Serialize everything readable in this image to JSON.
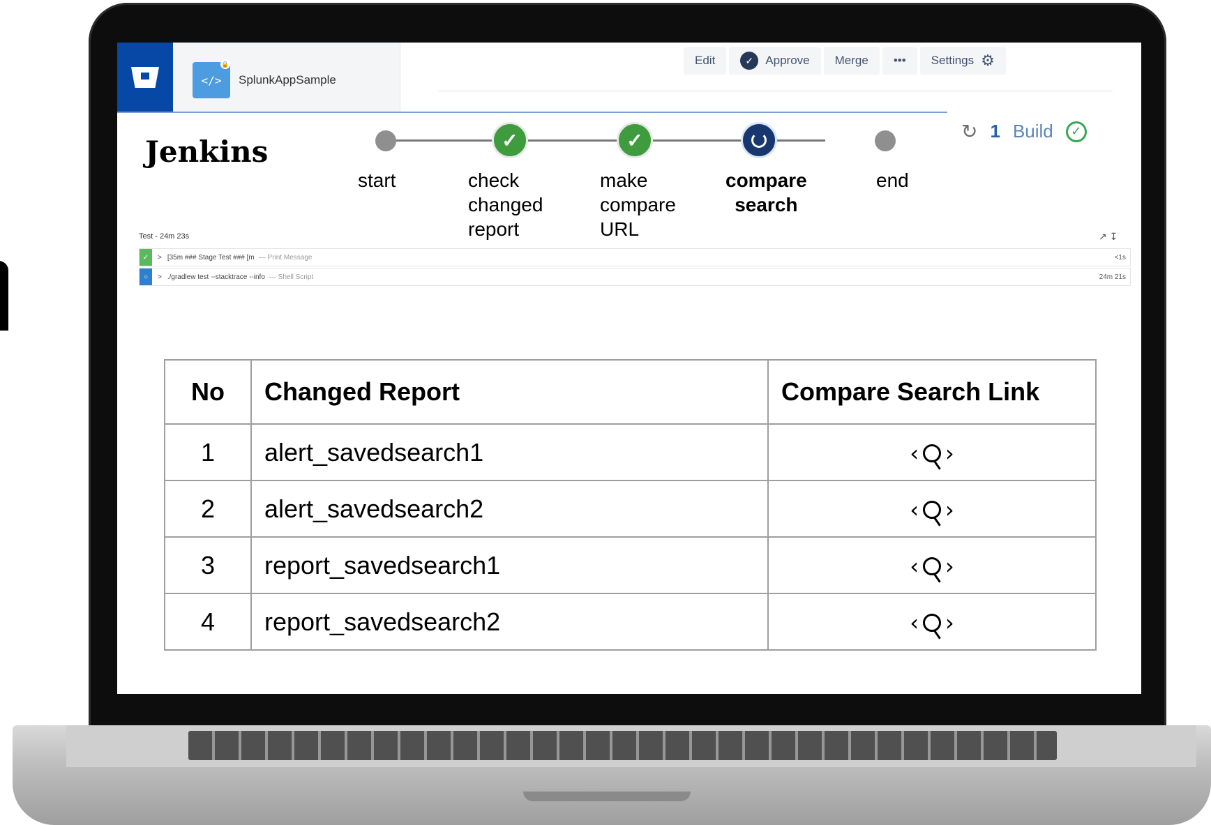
{
  "header": {
    "repo_name": "SplunkAppSample",
    "repo_icon_glyph": "</>",
    "actions": [
      {
        "label": "Edit"
      },
      {
        "label": "Approve",
        "icon": "check-circle-icon"
      },
      {
        "label": "Merge"
      },
      {
        "label": "•••"
      },
      {
        "label": "Settings",
        "icon": "gear-icon"
      }
    ],
    "build_count": "1",
    "build_label": "Build"
  },
  "jenkins": {
    "title": "Jenkins",
    "stages": [
      {
        "label": "start",
        "status": "pending"
      },
      {
        "label": "check\nchanged\nreport",
        "status": "success"
      },
      {
        "label": "make\ncompare\nURL",
        "status": "success"
      },
      {
        "label": "compare\nsearch",
        "status": "running"
      },
      {
        "label": "end",
        "status": "pending"
      }
    ]
  },
  "log": {
    "title": "Test - 24m 23s",
    "rows": [
      {
        "text": "[35m ### Stage Test ### [m",
        "kind": "— Print Message",
        "duration": "<1s",
        "status": "success",
        "color": "#5bb85d"
      },
      {
        "text": "./gradlew test --stacktrace --info",
        "kind": "— Shell Script",
        "duration": "24m 21s",
        "status": "running",
        "color": "#2f7fd0"
      }
    ]
  },
  "table": {
    "headers": [
      "No",
      "Changed Report",
      "Compare Search Link"
    ],
    "rows": [
      {
        "no": "1",
        "report": "alert_savedsearch1"
      },
      {
        "no": "2",
        "report": "alert_savedsearch2"
      },
      {
        "no": "3",
        "report": "report_savedsearch1"
      },
      {
        "no": "4",
        "report": "report_savedsearch2"
      }
    ],
    "link_icon": "compare-search-icon"
  },
  "colors": {
    "bitbucket_blue": "#0747a6",
    "success_green": "#3e9b3e",
    "running_navy": "#17376e"
  }
}
